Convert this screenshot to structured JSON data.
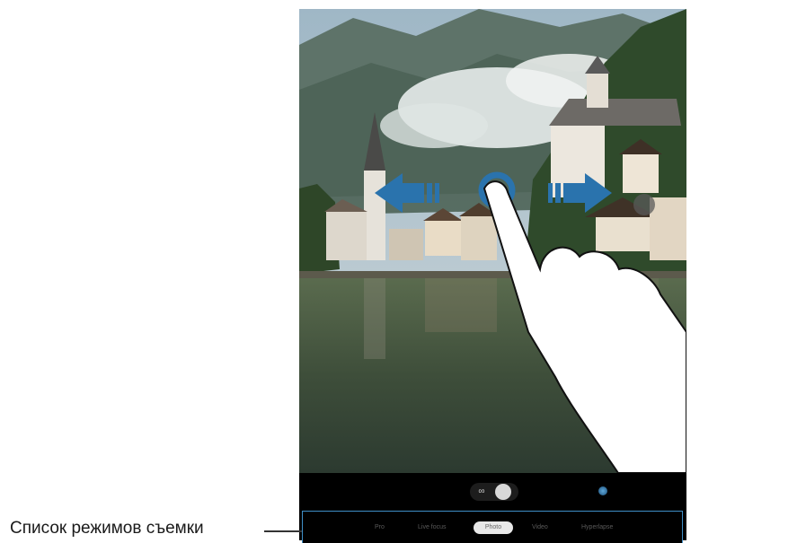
{
  "screen": "camera-viewfinder",
  "gesture": {
    "type": "swipe",
    "direction": "left-right"
  },
  "controls": {
    "effect_icon_a": "filter-effects-icon",
    "effect_icon_b": "beauty-icon",
    "gallery": "gallery-thumbnail-icon",
    "lens_switch": "switch-camera-icon"
  },
  "modes": {
    "items": [
      "Pro",
      "Live focus",
      "Photo",
      "Video",
      "Hyperlapse"
    ],
    "active": "Photo"
  },
  "caption": {
    "text": "Список режимов съемки"
  },
  "colors": {
    "accent": "#2a73ad",
    "highlight": "#3f8fc7"
  }
}
